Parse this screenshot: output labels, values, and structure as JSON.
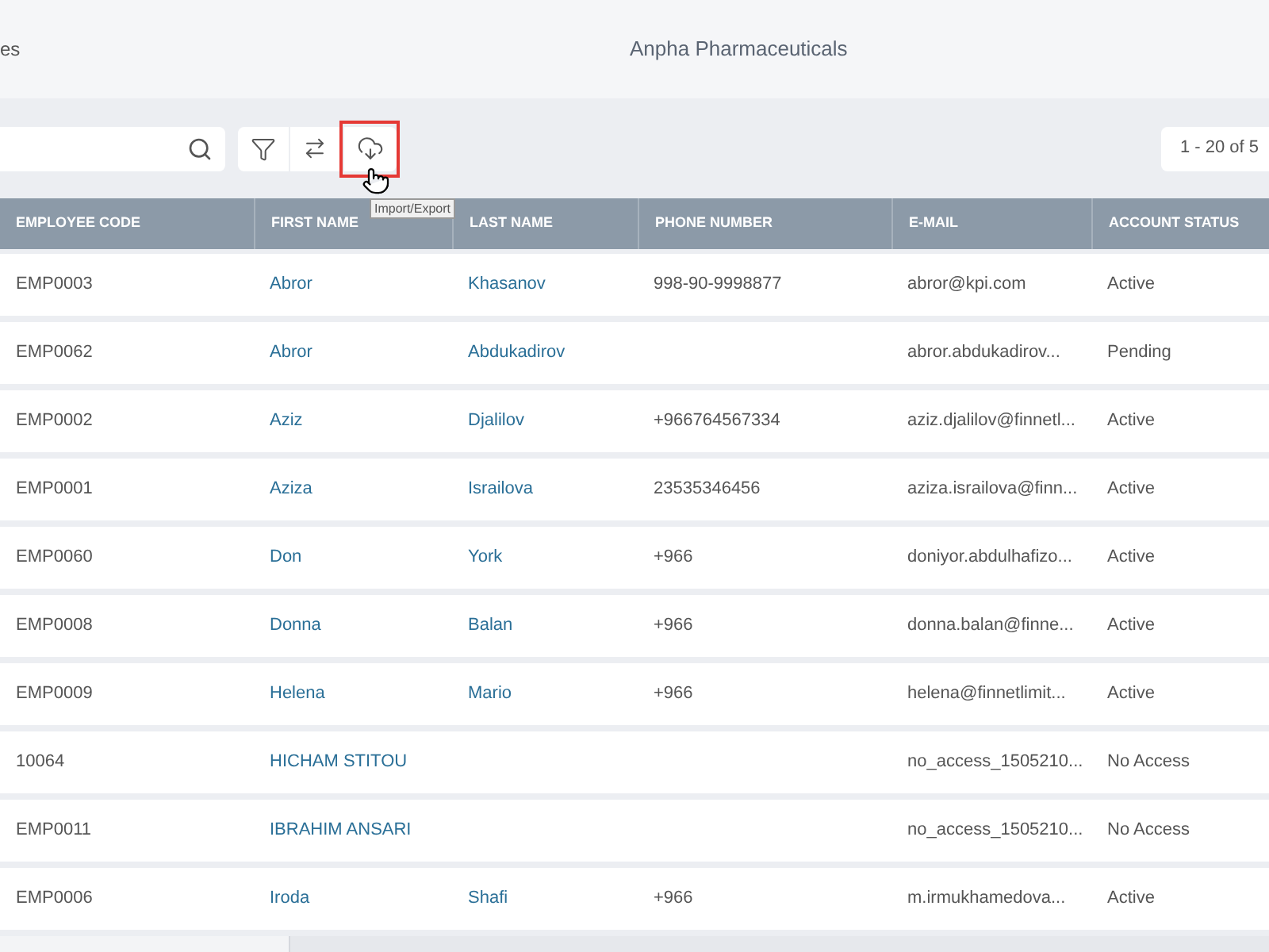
{
  "header": {
    "left_text": "es",
    "title": "Anpha Pharmaceuticals"
  },
  "toolbar": {
    "buttons": [
      {
        "kind": "filter",
        "highlighted": false
      },
      {
        "kind": "swap",
        "highlighted": false
      },
      {
        "kind": "cloud",
        "highlighted": true
      }
    ],
    "tooltip": "Import/Export",
    "pagination": "1 - 20 of 5"
  },
  "table": {
    "columns": [
      "EMPLOYEE CODE",
      "FIRST NAME",
      "LAST NAME",
      "PHONE NUMBER",
      "E-MAIL",
      "ACCOUNT STATUS"
    ],
    "rows": [
      {
        "code": "EMP0003",
        "first": "Abror",
        "last": "Khasanov",
        "phone": "998-90-9998877",
        "email": "abror@kpi.com",
        "status": "Active"
      },
      {
        "code": "EMP0062",
        "first": "Abror",
        "last": "Abdukadirov",
        "phone": "",
        "email": "abror.abdukadirov...",
        "status": "Pending"
      },
      {
        "code": "EMP0002",
        "first": "Aziz",
        "last": "Djalilov",
        "phone": "+966764567334",
        "email": "aziz.djalilov@finnetl...",
        "status": "Active"
      },
      {
        "code": "EMP0001",
        "first": "Aziza",
        "last": "Israilova",
        "phone": "23535346456",
        "email": "aziza.israilova@finn...",
        "status": "Active"
      },
      {
        "code": "EMP0060",
        "first": "Don",
        "last": "York",
        "phone": "+966",
        "email": "doniyor.abdulhafizo...",
        "status": "Active"
      },
      {
        "code": "EMP0008",
        "first": "Donna",
        "last": "Balan",
        "phone": "+966",
        "email": "donna.balan@finne...",
        "status": "Active"
      },
      {
        "code": "EMP0009",
        "first": "Helena",
        "last": "Mario",
        "phone": "+966",
        "email": "helena@finnetlimit...",
        "status": "Active"
      },
      {
        "code": "10064",
        "first": "HICHAM STITOU",
        "last": "",
        "phone": "",
        "email": "no_access_1505210...",
        "status": "No Access"
      },
      {
        "code": "EMP0011",
        "first": "IBRAHIM ANSARI",
        "last": "",
        "phone": "",
        "email": "no_access_1505210...",
        "status": "No Access"
      },
      {
        "code": "EMP0006",
        "first": "Iroda",
        "last": "Shafi",
        "phone": "+966",
        "email": "m.irmukhamedova...",
        "status": "Active"
      }
    ]
  }
}
